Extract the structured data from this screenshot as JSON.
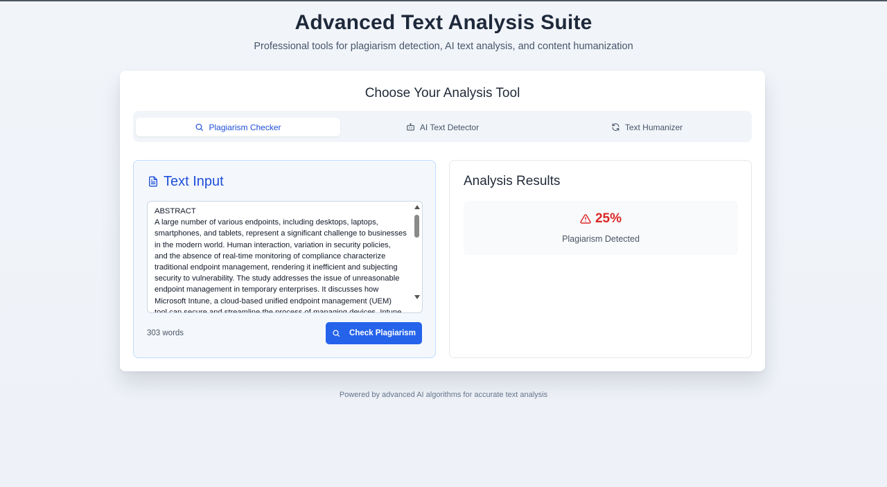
{
  "header": {
    "title": "Advanced Text Analysis Suite",
    "subtitle": "Professional tools for plagiarism detection, AI text analysis, and content humanization"
  },
  "tool_selector": {
    "title": "Choose Your Analysis Tool",
    "tabs": [
      {
        "label": "Plagiarism Checker",
        "icon": "search-icon",
        "active": true
      },
      {
        "label": "AI Text Detector",
        "icon": "bot-icon",
        "active": false
      },
      {
        "label": "Text Humanizer",
        "icon": "refresh-icon",
        "active": false
      }
    ]
  },
  "input_panel": {
    "heading": "Text Input",
    "icon": "document-icon",
    "text": "ABSTRACT\nA large number of various endpoints, including desktops, laptops,\nsmartphones, and tablets, represent a significant challenge to businesses\nin the modern world. Human interaction, variation in security policies,\nand the absence of real-time monitoring of compliance characterize\ntraditional endpoint management, rendering it inefficient and subjecting\nsecurity to vulnerability. The study addresses the issue of unreasonable\nendpoint management in temporary enterprises. It discusses how\nMicrosoft Intune, a cloud-based unified endpoint management (UEM)\ntool can secure and streamline the process of managing devices. Intune",
    "word_count": "303 words",
    "button_label": "Check Plagiarism"
  },
  "results_panel": {
    "heading": "Analysis Results",
    "percentage": "25%",
    "label": "Plagiarism Detected",
    "alert_color": "#dc2626"
  },
  "footer": {
    "text": "Powered by advanced AI algorithms for accurate text analysis"
  },
  "colors": {
    "accent": "#2563eb",
    "active_tab_text": "#1d4ed8",
    "danger": "#dc2626"
  }
}
